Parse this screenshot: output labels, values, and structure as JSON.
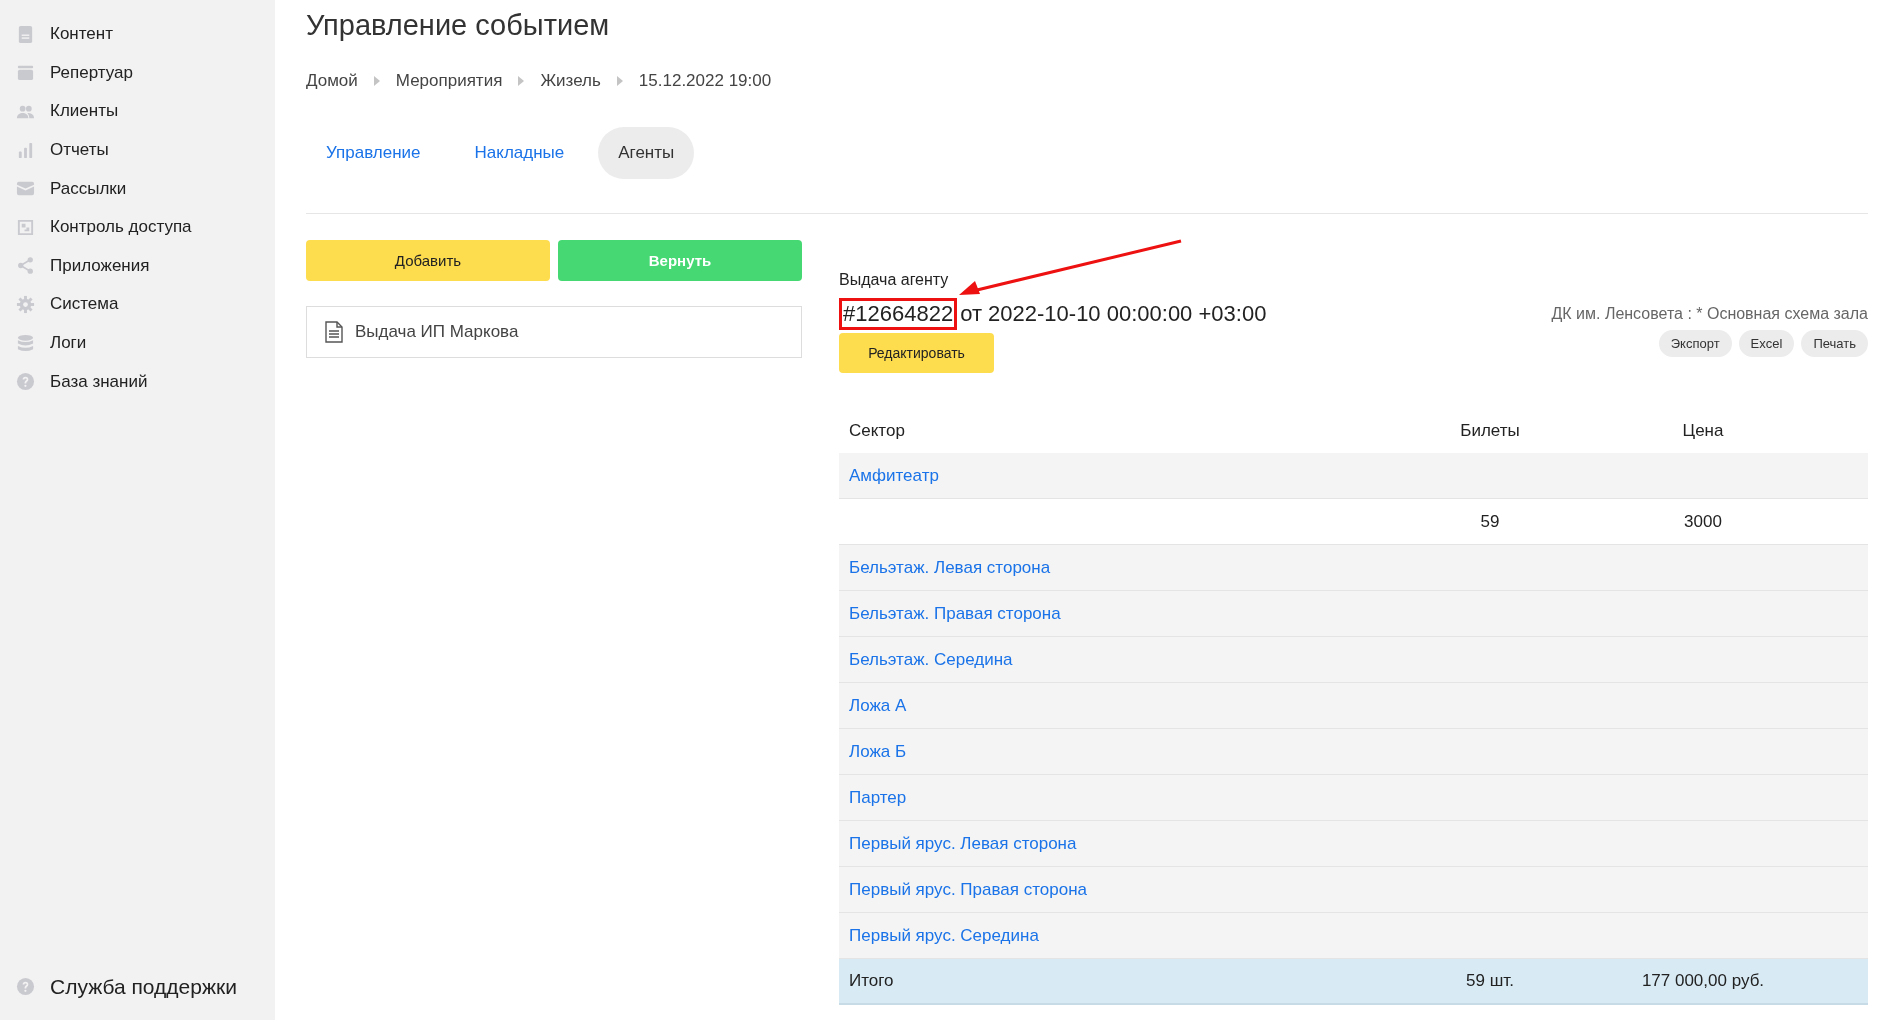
{
  "sidebar": {
    "items": [
      {
        "label": "Контент",
        "kind": "document"
      },
      {
        "label": "Репертуар",
        "kind": "calendar"
      },
      {
        "label": "Клиенты",
        "kind": "people"
      },
      {
        "label": "Отчеты",
        "kind": "bars"
      },
      {
        "label": "Рассылки",
        "kind": "envelope"
      },
      {
        "label": "Контроль доступа",
        "kind": "access"
      },
      {
        "label": "Приложения",
        "kind": "share"
      },
      {
        "label": "Система",
        "kind": "gear"
      },
      {
        "label": "Логи",
        "kind": "database"
      },
      {
        "label": "База знаний",
        "kind": "help"
      }
    ],
    "footer": {
      "label": "Служба поддержки",
      "kind": "help"
    }
  },
  "page": {
    "title": "Управление событием",
    "breadcrumbs": [
      "Домой",
      "Мероприятия",
      "Жизель",
      "15.12.2022 19:00"
    ],
    "tabs": [
      {
        "label": "Управление",
        "selected": false
      },
      {
        "label": "Накладные",
        "selected": false
      },
      {
        "label": "Агенты",
        "selected": true
      }
    ]
  },
  "left": {
    "buttons": [
      {
        "label": "Добавить",
        "kind": "yellow"
      },
      {
        "label": "Вернуть",
        "kind": "green"
      }
    ],
    "documents": [
      "Выдача ИП Маркова"
    ]
  },
  "issue": {
    "caption": "Выдача агенту",
    "number": "#12664822",
    "date": "от 2022-10-10 00:00:00 +03:00",
    "venue": "ДК им. Ленсовета : * Основная схема зала",
    "edit_button": "Редактировать",
    "actions": [
      "Экспорт",
      "Excel",
      "Печать"
    ]
  },
  "table": {
    "columns": [
      "Сектор",
      "Билеты",
      "Цена"
    ],
    "rows": [
      {
        "kind": "sector",
        "name": "Амфитеатр"
      },
      {
        "kind": "values",
        "tickets": "59",
        "price": "3000"
      },
      {
        "kind": "sector",
        "name": "Бельэтаж. Левая сторона"
      },
      {
        "kind": "sector",
        "name": "Бельэтаж. Правая сторона"
      },
      {
        "kind": "sector",
        "name": "Бельэтаж. Середина"
      },
      {
        "kind": "sector",
        "name": "Ложа А"
      },
      {
        "kind": "sector",
        "name": "Ложа Б"
      },
      {
        "kind": "sector",
        "name": "Партер"
      },
      {
        "kind": "sector",
        "name": "Первый ярус. Левая сторона"
      },
      {
        "kind": "sector",
        "name": "Первый ярус. Правая сторона"
      },
      {
        "kind": "sector",
        "name": "Первый ярус. Середина"
      }
    ],
    "total": {
      "label": "Итого",
      "tickets": "59 шт.",
      "price": "177 000,00 руб."
    }
  }
}
